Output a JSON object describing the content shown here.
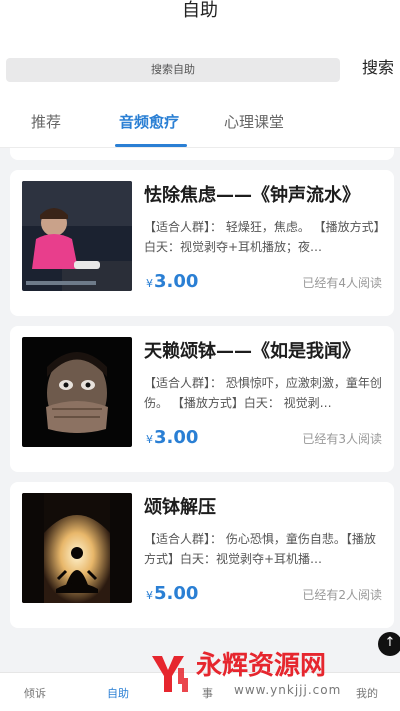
{
  "header": {
    "title": "自助"
  },
  "search": {
    "placeholder": "搜索自助",
    "button_label": "搜索"
  },
  "tabs": [
    {
      "label": "推荐",
      "active": false
    },
    {
      "label": "音频愈疗",
      "active": true
    },
    {
      "label": "心理课堂",
      "active": false
    }
  ],
  "cards": [
    {
      "title": "怯除焦虑——《钟声流水》",
      "desc": "【适合人群】： 轻燥狂，焦虑。 【播放方式】白天：视觉剥夺+耳机播放；夜…",
      "currency": "¥",
      "price": "3.00",
      "readers": "已经有4人阅读",
      "image_icon": "child-on-floor-photo"
    },
    {
      "title": "天赖颂钵——《如是我闻》",
      "desc": "【适合人群】： 恐惧惊吓，应激刺激，童年创伤。 【播放方式】白天： 视觉剥…",
      "currency": "¥",
      "price": "3.00",
      "readers": "已经有3人阅读",
      "image_icon": "frightened-face-photo"
    },
    {
      "title": "颂钵解压",
      "desc": "【适合人群】： 伤心恐惧，童伤自悲。【播放方式】白天：视觉剥夺+耳机播…",
      "currency": "¥",
      "price": "5.00",
      "readers": "已经有2人阅读",
      "image_icon": "meditation-silhouette-photo"
    }
  ],
  "back_to_top": {
    "icon": "arrow-up-icon",
    "label": "↑"
  },
  "bottom_nav": [
    {
      "label": "倾诉",
      "active": false
    },
    {
      "label": "自助",
      "active": true
    },
    {
      "label": "事",
      "active": false
    },
    {
      "label": "我的",
      "active": false
    }
  ],
  "watermark": {
    "text": "永辉资源网",
    "url": "www.ynkjjj.com"
  },
  "colors": {
    "accent": "#2a7fd4",
    "background": "#f2f3f5",
    "watermark_red": "#e6262e"
  }
}
